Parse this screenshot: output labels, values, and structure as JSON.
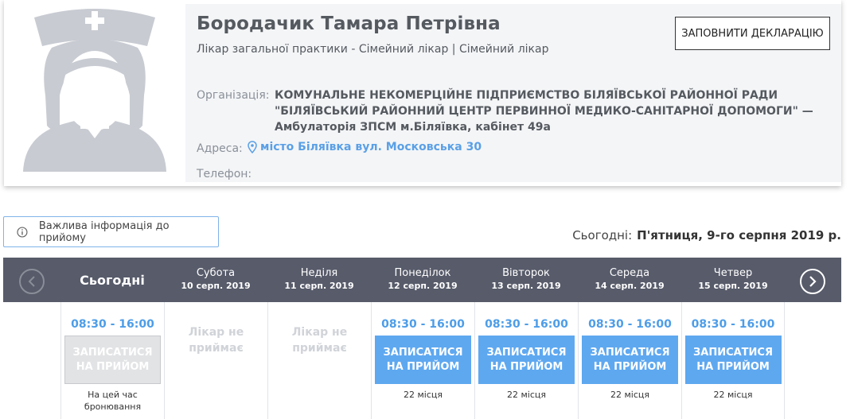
{
  "doctor": {
    "name": "Бородачик Тамара Петрівна",
    "specialty": "Лікар загальної практики - Сімейний лікар | Сімейний лікар",
    "declaration_button": "ЗАПОВНИТИ ДЕКЛАРАЦІЮ",
    "organization_label": "Організація:",
    "organization": "КОМУНАЛЬНЕ НЕКОМЕРЦІЙНЕ ПІДПРИЄМСТВО БІЛЯЇВСЬКОЇ РАЙОННОЇ РАДИ \"БІЛЯЇВСЬКИЙ РАЙОННИЙ ЦЕНТР ПЕРВИННОЇ МЕДИКО-САНІТАРНОЇ ДОПОМОГИ\" — Амбулаторія ЗПСМ м.Біляївка, кабінет 49а",
    "address_label": "Адреса:",
    "address": "місто Біляївка вул. Московська 30",
    "phone_label": "Телефон:",
    "icons": {
      "avatar": "nurse-avatar-icon",
      "address": "map-pin-icon"
    }
  },
  "info_button": {
    "label": "Важлива інформація до прийому",
    "icon": "info-icon"
  },
  "today_label": "Сьогодні:",
  "today_date": "П'ятниця, 9-го серпня 2019 р.",
  "calendar": {
    "today_header": "Сьогодні",
    "days": [
      {
        "name": "Субота",
        "date": "10 серп. 2019"
      },
      {
        "name": "Неділя",
        "date": "11 серп. 2019"
      },
      {
        "name": "Понеділок",
        "date": "12 серп. 2019"
      },
      {
        "name": "Вівторок",
        "date": "13 серп. 2019"
      },
      {
        "name": "Середа",
        "date": "14 серп. 2019"
      },
      {
        "name": "Четвер",
        "date": "15 серп. 2019"
      }
    ],
    "today_slot": {
      "time": "08:30 - 16:00",
      "button": "ЗАПИСАТИСЯ НА ПРИЙОМ",
      "note": "На цей час бронювання"
    },
    "no_appointment": "Лікар не приймає",
    "slot_time": "08:30 - 16:00",
    "book_button": "ЗАПИСАТИСЯ НА ПРИЙОМ",
    "places": "22 місця"
  },
  "colors": {
    "header_bg": "#575b6a",
    "accent": "#5ea8f0",
    "info_bg": "#f4f5f7"
  }
}
